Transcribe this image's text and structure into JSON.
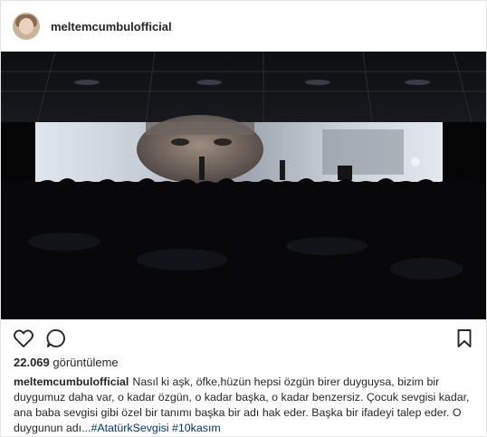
{
  "post": {
    "username": "meltemcumbulofficial",
    "views_count": "22.069",
    "views_label": "görüntüleme",
    "caption_text": "Nasıl ki aşk, öfke,hüzün hepsi özgün birer duyguysa, bizim bir duygumuz daha var, o kadar özgün, o kadar başka, o kadar benzersiz. Çocuk sevgisi kadar, ana baba sevgisi gibi özel bir tanımı başka bir adı hak eder. Başka bir ifadeyi talep eder. O duygunun adı...",
    "hashtags": [
      "#AtatürkSevgisi",
      "#10kasım"
    ]
  },
  "icons": {
    "avatar": "profile-avatar",
    "like": "heart-icon",
    "comment": "comment-bubble-icon",
    "save": "bookmark-icon"
  },
  "colors": {
    "text": "#262626",
    "hashtag": "#003569",
    "border": "#e6e6e6",
    "media_bg": "#050506"
  }
}
